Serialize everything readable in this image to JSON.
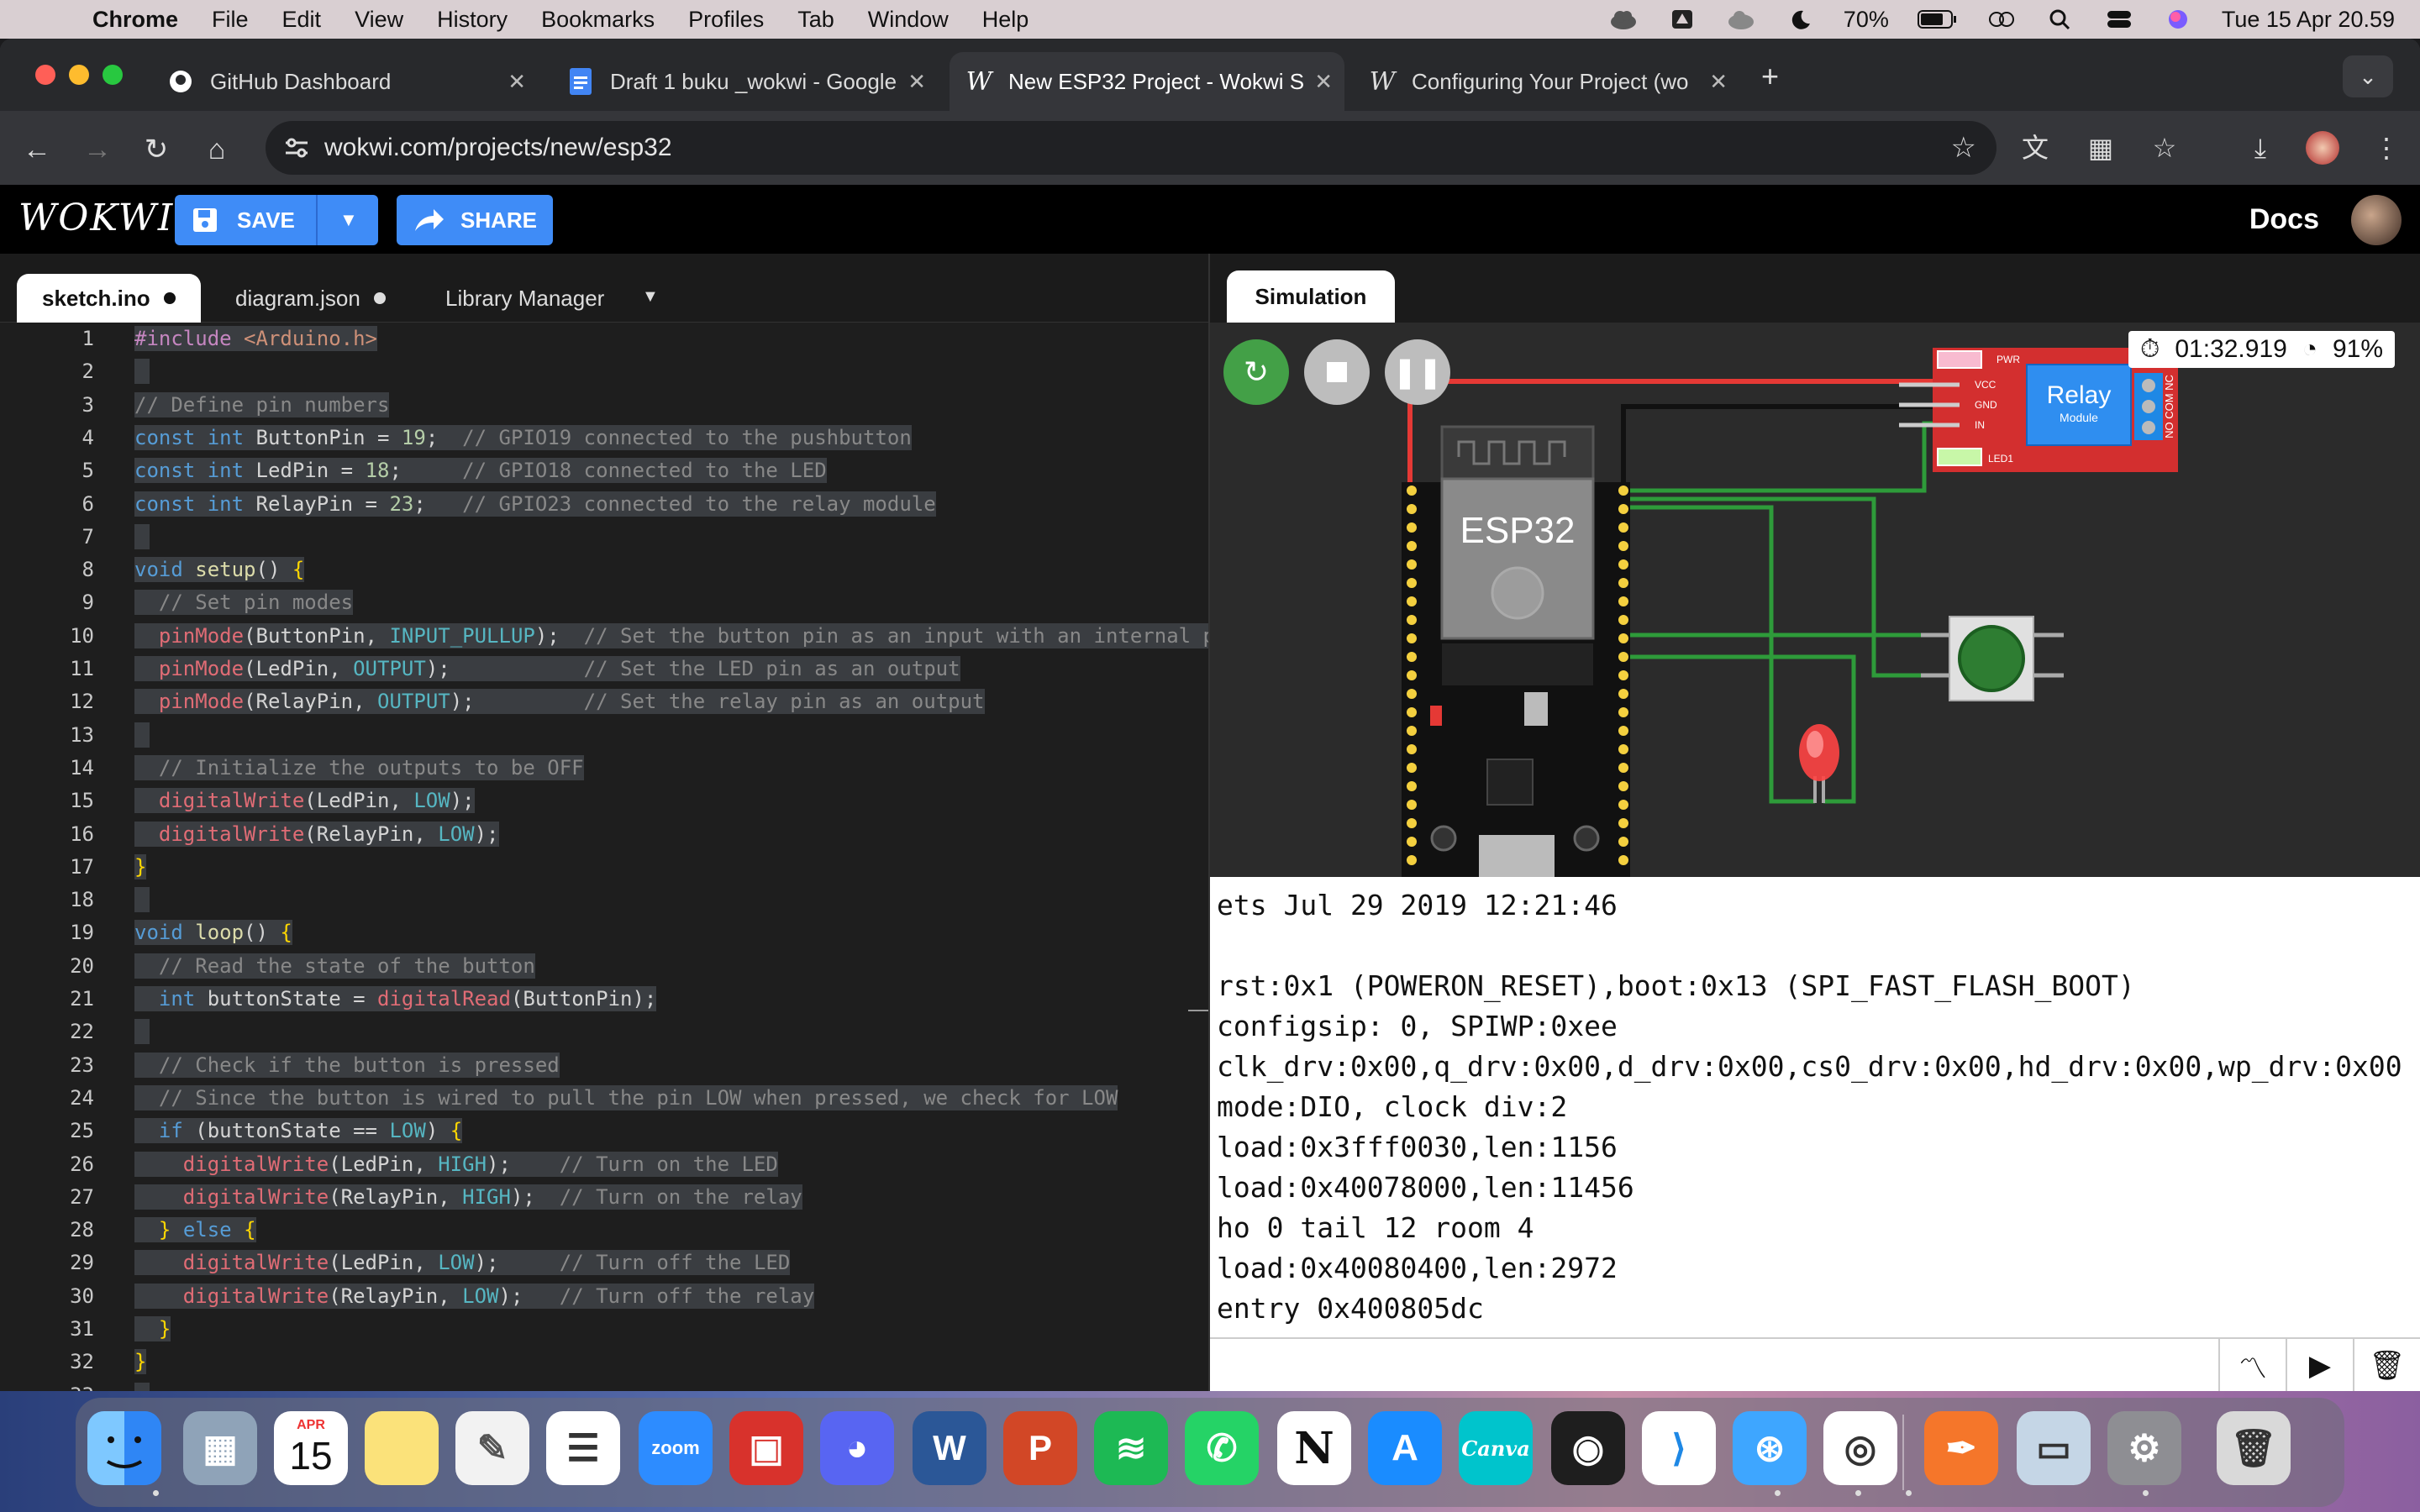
{
  "menubar": {
    "app": "Chrome",
    "items": [
      "File",
      "Edit",
      "View",
      "History",
      "Bookmarks",
      "Profiles",
      "Tab",
      "Window",
      "Help"
    ],
    "battery": "70%",
    "datetime": "Tue 15 Apr  20.59"
  },
  "tabs": [
    {
      "title": "GitHub Dashboard",
      "icon": "github-icon"
    },
    {
      "title": "Draft 1 buku _wokwi - Google",
      "icon": "docs-icon"
    },
    {
      "title": "New ESP32 Project - Wokwi S",
      "icon": "wokwi-icon"
    },
    {
      "title": "Configuring Your Project (wo",
      "icon": "wokwi-icon"
    }
  ],
  "url": "wokwi.com/projects/new/esp32",
  "wokwi": {
    "logo": "WOKWI",
    "save": "SAVE",
    "share": "SHARE",
    "docs": "Docs"
  },
  "editor": {
    "tabs": [
      "sketch.ino",
      "diagram.json",
      "Library Manager"
    ],
    "lines": [
      "#include <Arduino.h>",
      "",
      "// Define pin numbers",
      "const int ButtonPin = 19;  // GPIO19 connected to the pushbutton",
      "const int LedPin = 18;     // GPIO18 connected to the LED",
      "const int RelayPin = 23;   // GPIO23 connected to the relay module",
      "",
      "void setup() {",
      "  // Set pin modes",
      "  pinMode(ButtonPin, INPUT_PULLUP);  // Set the button pin as an input with an internal p",
      "  pinMode(LedPin, OUTPUT);           // Set the LED pin as an output",
      "  pinMode(RelayPin, OUTPUT);         // Set the relay pin as an output",
      "",
      "  // Initialize the outputs to be OFF",
      "  digitalWrite(LedPin, LOW);",
      "  digitalWrite(RelayPin, LOW);",
      "}",
      "",
      "void loop() {",
      "  // Read the state of the button",
      "  int buttonState = digitalRead(ButtonPin);",
      "",
      "  // Check if the button is pressed",
      "  // Since the button is wired to pull the pin LOW when pressed, we check for LOW",
      "  if (buttonState == LOW) {",
      "    digitalWrite(LedPin, HIGH);    // Turn on the LED",
      "    digitalWrite(RelayPin, HIGH);  // Turn on the relay",
      "  } else {",
      "    digitalWrite(LedPin, LOW);     // Turn off the LED",
      "    digitalWrite(RelayPin, LOW);   // Turn off the relay",
      "  }",
      "}",
      ""
    ]
  },
  "simulation": {
    "tab": "Simulation",
    "timer": "01:32.919",
    "speed": "91%",
    "esp_label": "ESP32",
    "relay_label": "Relay",
    "relay_sub": "Module",
    "relay_pins": [
      "PWR",
      "VCC",
      "GND",
      "IN",
      "LED1"
    ],
    "relay_terms": "NO COM NC",
    "serial": [
      "ets Jul 29 2019 12:21:46",
      "",
      "rst:0x1 (POWERON_RESET),boot:0x13 (SPI_FAST_FLASH_BOOT)",
      "configsip: 0, SPIWP:0xee",
      "clk_drv:0x00,q_drv:0x00,d_drv:0x00,cs0_drv:0x00,hd_drv:0x00,wp_drv:0x00",
      "mode:DIO, clock div:2",
      "load:0x3fff0030,len:1156",
      "load:0x40078000,len:11456",
      "ho 0 tail 12 room 4",
      "load:0x40080400,len:2972",
      "entry 0x400805dc"
    ]
  },
  "dock": {
    "calendar_month": "APR",
    "calendar_day": "15",
    "apps": [
      "finder",
      "launchpad",
      "calendar",
      "notes",
      "textedit",
      "reminders",
      "zoom",
      "photo-booth",
      "discord",
      "word",
      "powerpoint",
      "spotify",
      "whatsapp",
      "notion",
      "app-store",
      "canva",
      "figma",
      "vscode",
      "safari",
      "chrome",
      "pages",
      "preview",
      "system-settings",
      "trash"
    ],
    "zoom_label": "zoom",
    "canva_label": "Canva",
    "notion_label": "N",
    "word_label": "W",
    "ppt_label": "P"
  }
}
